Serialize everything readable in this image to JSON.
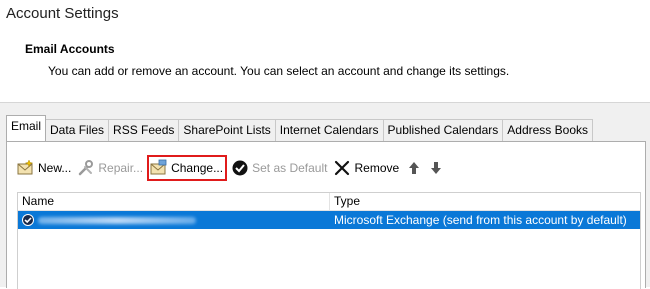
{
  "window": {
    "title": "Account Settings"
  },
  "section": {
    "title": "Email Accounts",
    "description": "You can add or remove an account. You can select an account and change its settings."
  },
  "tabs": [
    {
      "label": "Email",
      "active": true
    },
    {
      "label": "Data Files"
    },
    {
      "label": "RSS Feeds"
    },
    {
      "label": "SharePoint Lists"
    },
    {
      "label": "Internet Calendars"
    },
    {
      "label": "Published Calendars"
    },
    {
      "label": "Address Books"
    }
  ],
  "toolbar": {
    "new_label": "New...",
    "repair_label": "Repair...",
    "change_label": "Change...",
    "set_default_label": "Set as Default",
    "remove_label": "Remove"
  },
  "grid": {
    "columns": [
      "Name",
      "Type"
    ],
    "rows": [
      {
        "name": "",
        "type": "Microsoft Exchange (send from this account by default)",
        "selected": true
      }
    ]
  },
  "colors": {
    "selection": "#0a78d7",
    "highlight_outline": "#e01b1b"
  }
}
